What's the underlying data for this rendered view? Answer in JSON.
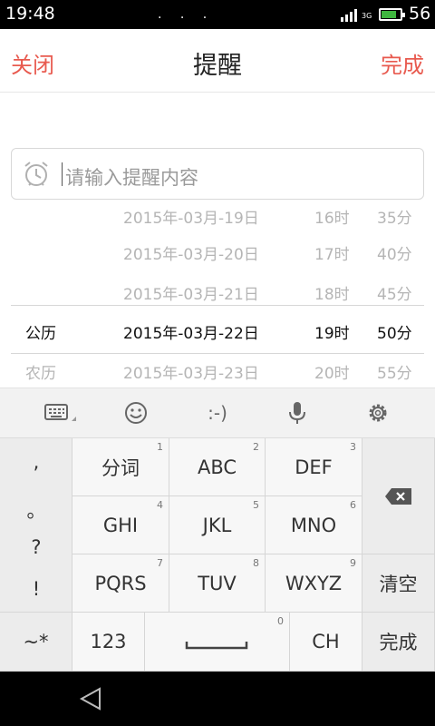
{
  "status_bar": {
    "time": "19:48",
    "dots": ". . .",
    "network": "3G",
    "battery_level": "56",
    "battery_fill": 0.8,
    "battery_color": "#3fb53f"
  },
  "header": {
    "close_label": "关闭",
    "title": "提醒",
    "done_label": "完成",
    "accent_color": "#e85a4f"
  },
  "reminder_input": {
    "placeholder": "请输入提醒内容",
    "icon": "alarm-clock-icon"
  },
  "picker": {
    "rows": [
      {
        "calendar": "",
        "date": "2015年-03月-19日",
        "hour": "16时",
        "minute": "35分"
      },
      {
        "calendar": "",
        "date": "2015年-03月-20日",
        "hour": "17时",
        "minute": "40分"
      },
      {
        "calendar": "",
        "date": "2015年-03月-21日",
        "hour": "18时",
        "minute": "45分"
      },
      {
        "calendar": "公历",
        "date": "2015年-03月-22日",
        "hour": "19时",
        "minute": "50分"
      },
      {
        "calendar": "农历",
        "date": "2015年-03月-23日",
        "hour": "20时",
        "minute": "55分"
      }
    ],
    "selected_index": 3
  },
  "keyboard_toolbar": {
    "items": [
      "keyboard-icon",
      "smiley-icon",
      ":-)",
      "microphone-icon",
      "gear-icon"
    ],
    "emoticon": ":-)"
  },
  "keyboard": {
    "side_symbols": [
      ",",
      "。",
      "?",
      "!"
    ],
    "tilde_key": "~*",
    "keys": [
      {
        "label": "分词",
        "num": "1"
      },
      {
        "label": "ABC",
        "num": "2"
      },
      {
        "label": "DEF",
        "num": "3"
      },
      {
        "label": "GHI",
        "num": "4"
      },
      {
        "label": "JKL",
        "num": "5"
      },
      {
        "label": "MNO",
        "num": "6"
      },
      {
        "label": "PQRS",
        "num": "7"
      },
      {
        "label": "TUV",
        "num": "8"
      },
      {
        "label": "WXYZ",
        "num": "9"
      }
    ],
    "num_key": "123",
    "space_num": "0",
    "ch_key": "CH",
    "clear_key": "清空",
    "done_key": "完成",
    "backspace_icon": "backspace-icon"
  },
  "nav_bar": {
    "back_icon": "back-triangle-icon"
  }
}
